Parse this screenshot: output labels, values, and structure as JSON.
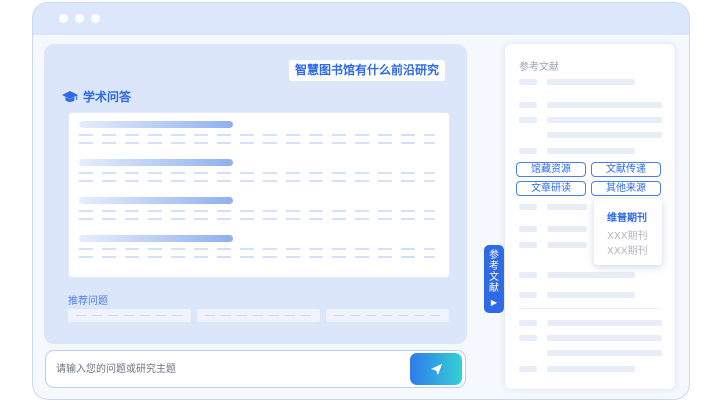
{
  "main": {
    "query": "智慧图书馆有什么前沿研究",
    "section_title": "学术问答",
    "recommended_label": "推荐问题"
  },
  "search": {
    "placeholder": "请输入您的问题或研究主题"
  },
  "reference_tab": {
    "chars": [
      "参",
      "考",
      "文",
      "献"
    ],
    "arrow": "▶"
  },
  "reference_panel": {
    "title": "参考文献",
    "filters": [
      "馆藏资源",
      "文献传递",
      "文章研读",
      "其他来源"
    ]
  },
  "dropdown": {
    "items": [
      "维普期刊",
      "XXX期刊",
      "XXX期刊"
    ]
  },
  "colors": {
    "accent": "#2f6ae6",
    "panel": "#dbe6fb",
    "send_gradient": [
      "#2f7bea",
      "#34d0d6"
    ]
  },
  "icons": {
    "section": "graduation-cap-icon",
    "send": "paper-plane-icon"
  }
}
